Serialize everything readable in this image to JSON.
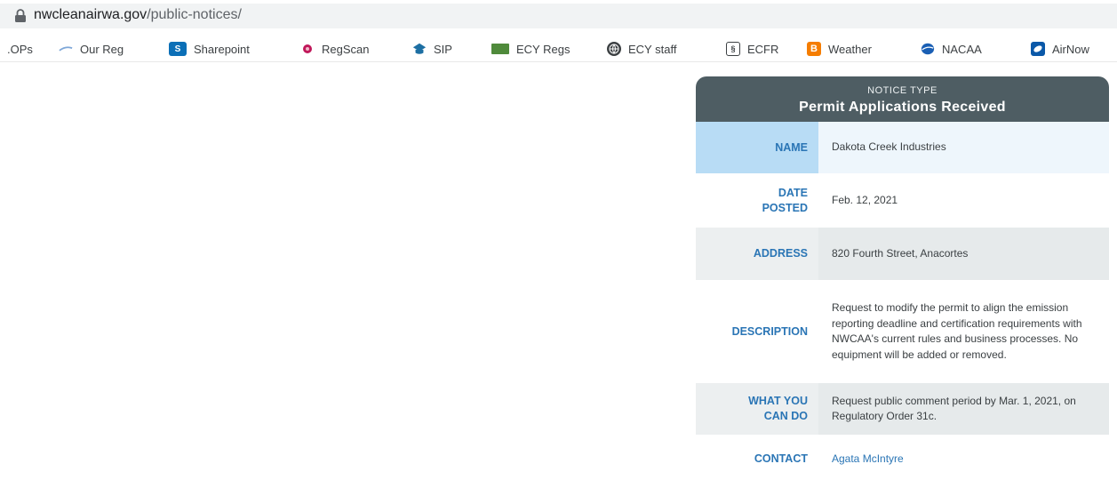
{
  "browser": {
    "url_host": "nwcleanairwa.gov",
    "url_path": "/public-notices/",
    "bookmarks": [
      {
        "label": ".OPs",
        "icon": "none"
      },
      {
        "label": "Our Reg",
        "icon": "swoosh-icon"
      },
      {
        "label": "Sharepoint",
        "icon": "sharepoint-icon"
      },
      {
        "label": "RegScan",
        "icon": "regscan-icon"
      },
      {
        "label": "SIP",
        "icon": "sip-icon"
      },
      {
        "label": "ECY Regs",
        "icon": "ecy-icon"
      },
      {
        "label": "ECY staff",
        "icon": "globe-icon"
      },
      {
        "label": "ECFR",
        "icon": "ecfr-icon"
      },
      {
        "label": "Weather",
        "icon": "blogger-icon"
      },
      {
        "label": "NACAA",
        "icon": "nacaa-icon"
      },
      {
        "label": "AirNow",
        "icon": "airnow-icon"
      }
    ]
  },
  "notice": {
    "kicker": "NOTICE TYPE",
    "type": "Permit Applications Received",
    "rows": [
      {
        "label": "NAME",
        "value": "Dakota Creek Industries"
      },
      {
        "label": "DATE POSTED",
        "value": "Feb. 12, 2021"
      },
      {
        "label": "ADDRESS",
        "value": "820 Fourth Street, Anacortes"
      },
      {
        "label": "DESCRIPTION",
        "value": "Request to modify the permit to align the emission reporting deadline and certification requirements with NWCAA's current rules and business processes. No equipment will be added or removed."
      },
      {
        "label": "WHAT YOU CAN DO",
        "value": "Request public comment period by Mar. 1, 2021, on Regulatory Order 31c."
      },
      {
        "label": "CONTACT",
        "value": "Agata McIntyre"
      }
    ]
  },
  "colors": {
    "header": "#4e5d63",
    "label_blue": "#2a75b5",
    "highlight": "#b8dcf5"
  }
}
